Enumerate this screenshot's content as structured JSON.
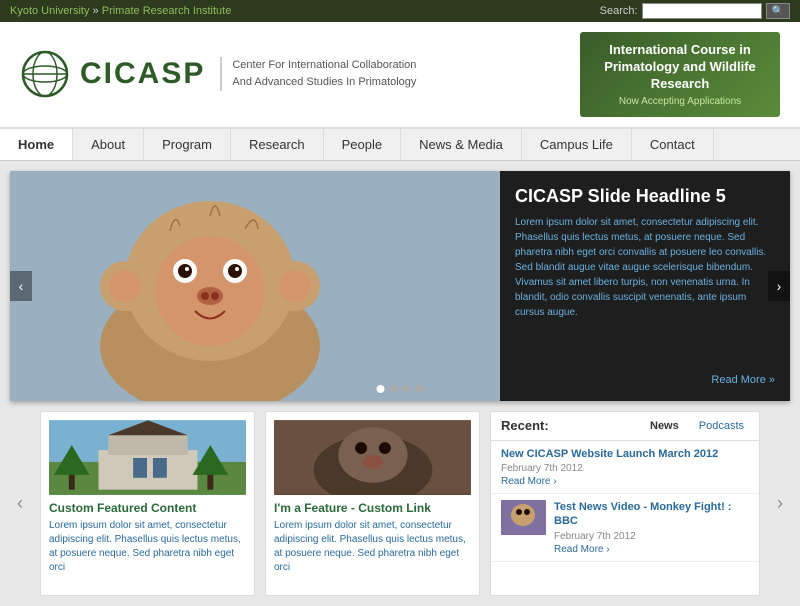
{
  "topbar": {
    "breadcrumb1": "Kyoto University",
    "separator": " » ",
    "breadcrumb2": "Primate Research Institute",
    "search_label": "Search:",
    "search_placeholder": ""
  },
  "header": {
    "logo_alt": "CICASP Globe Logo",
    "site_name": "CICASP",
    "tagline_line1": "Center For International Collaboration",
    "tagline_line2": "And Advanced Studies In Primatology",
    "banner": {
      "title": "International Course in Primatology and Wildlife Research",
      "sub": "Now Accepting Applications"
    }
  },
  "nav": {
    "items": [
      {
        "label": "Home",
        "id": "home"
      },
      {
        "label": "About",
        "id": "about"
      },
      {
        "label": "Program",
        "id": "program"
      },
      {
        "label": "Research",
        "id": "research"
      },
      {
        "label": "People",
        "id": "people"
      },
      {
        "label": "News & Media",
        "id": "news-media"
      },
      {
        "label": "Campus Life",
        "id": "campus-life"
      },
      {
        "label": "Contact",
        "id": "contact"
      }
    ]
  },
  "slideshow": {
    "headline": "CICASP Slide Headline 5",
    "body": "Lorem ipsum dolor sit amet, consectetur adipiscing elit. Phasellus quis lectus metus, at posuere neque. Sed pharetra nibh eget orci convallis at posuere leo convallis. Sed blandit augue vitae augue scelerisque bibendum. Vivamus sit amet libero turpis, non venenatis urna. In blandit, odio convallis suscipit venenatis, ante ipsum cursus augue.",
    "read_more": "Read More »",
    "dots": 4,
    "active_dot": 0,
    "prev_label": "‹",
    "next_label": "›"
  },
  "cards": [
    {
      "title": "Custom Featured Content",
      "body": "Lorem ipsum dolor sit amet, consectetur adipiscing elit. Phasellus quis lectus metus, at posuere neque. Sed pharetra nibh eget orci"
    },
    {
      "title": "I'm a Feature - Custom Link",
      "body": "Lorem ipsum dolor sit amet, consectetur adipiscing elit. Phasellus quis lectus metus, at posuere neque. Sed pharetra nibh eget orci"
    }
  ],
  "sidebar": {
    "title": "Recent:",
    "tabs": [
      {
        "label": "News",
        "active": true
      },
      {
        "label": "Podcasts",
        "active": false
      }
    ],
    "news": [
      {
        "title": "New CICASP Website Launch March 2012",
        "date": "February 7th 2012",
        "read_more": "Read More ›",
        "has_thumb": false
      },
      {
        "title": "Test News Video - Monkey Fight! : BBC",
        "date": "February 7th 2012",
        "read_more": "Read More ›",
        "has_thumb": true
      }
    ]
  },
  "arrows": {
    "left": "‹",
    "right": "›"
  }
}
